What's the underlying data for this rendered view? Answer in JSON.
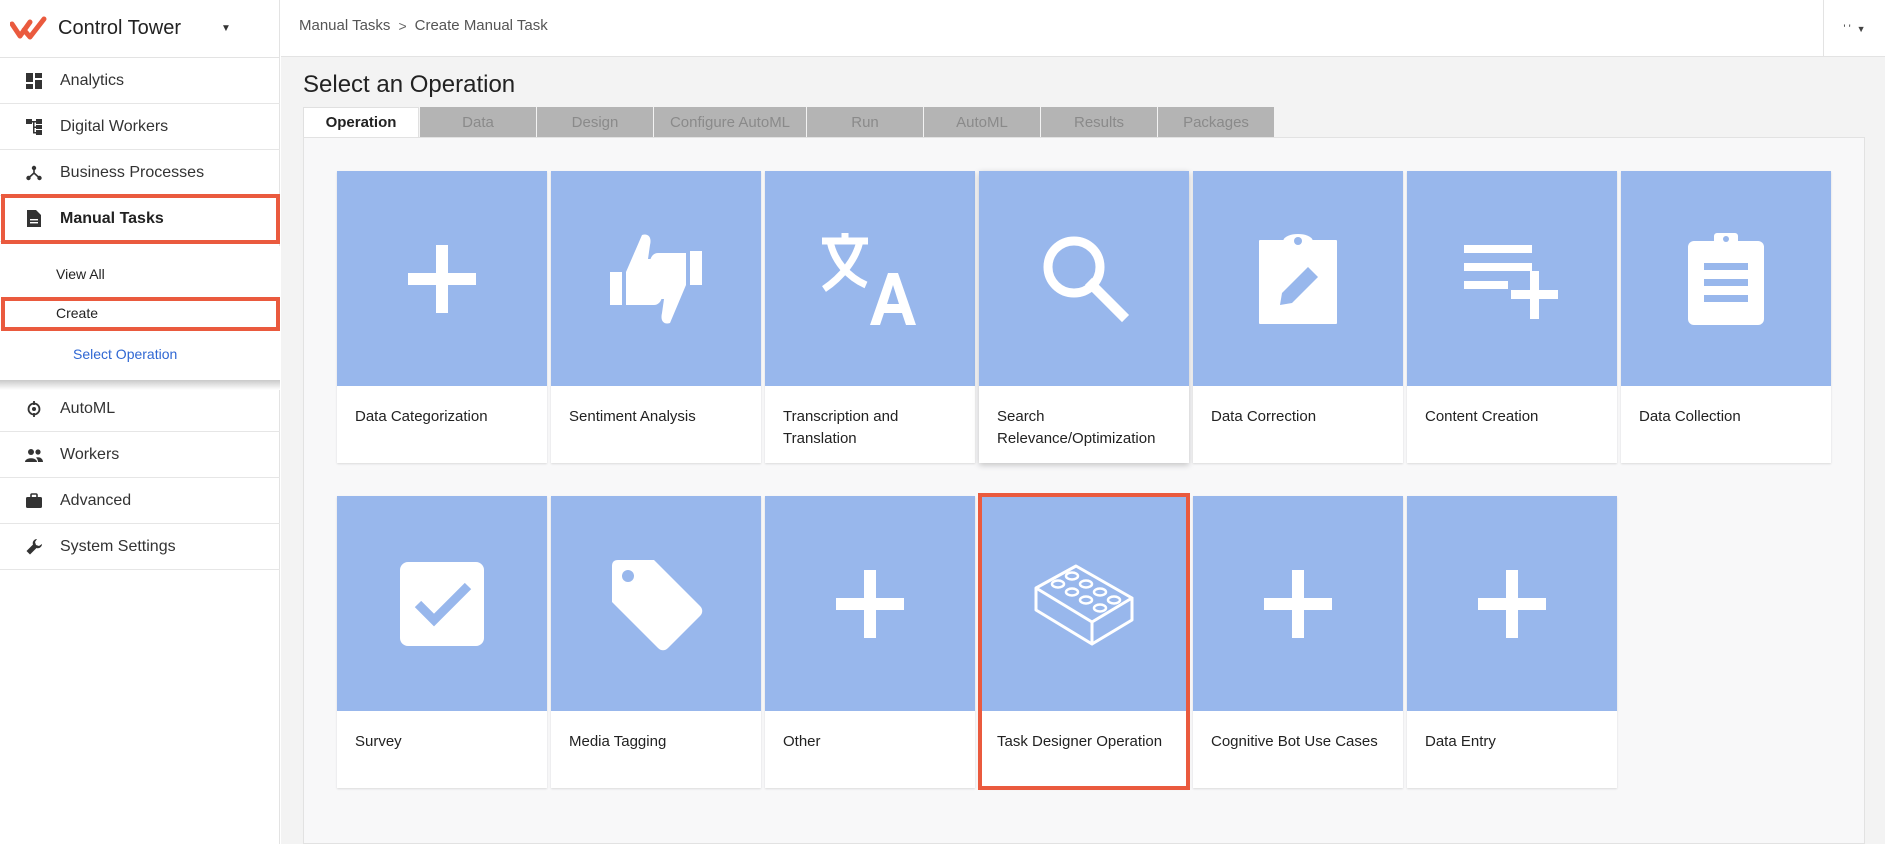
{
  "app": {
    "name": "Control Tower"
  },
  "user_menu": {
    "label": "' '"
  },
  "breadcrumb": [
    "Manual Tasks",
    "Create Manual Task"
  ],
  "sidebar": {
    "items": [
      {
        "label": "Analytics",
        "icon": "dashboard-icon"
      },
      {
        "label": "Digital Workers",
        "icon": "org-tree-icon"
      },
      {
        "label": "Business Processes",
        "icon": "process-hub-icon"
      },
      {
        "label": "Manual Tasks",
        "icon": "document-icon"
      },
      {
        "label": "AutoML",
        "icon": "automl-icon"
      },
      {
        "label": "Workers",
        "icon": "people-icon"
      },
      {
        "label": "Advanced",
        "icon": "briefcase-icon"
      },
      {
        "label": "System Settings",
        "icon": "wrench-icon"
      }
    ],
    "sub_items": {
      "view_all": "View All",
      "create": "Create",
      "select_operation": "Select Operation"
    }
  },
  "page": {
    "title": "Select an Operation"
  },
  "tabs": [
    "Operation",
    "Data",
    "Design",
    "Configure AutoML",
    "Run",
    "AutoML",
    "Results",
    "Packages"
  ],
  "operations": [
    {
      "label": "Data Categorization",
      "icon": "plus-icon"
    },
    {
      "label": "Sentiment Analysis",
      "icon": "thumbs-icon"
    },
    {
      "label": "Transcription and Translation",
      "icon": "translate-icon"
    },
    {
      "label": "Search Relevance/Optimization",
      "icon": "search-icon"
    },
    {
      "label": "Data Correction",
      "icon": "clipboard-edit-icon"
    },
    {
      "label": "Content Creation",
      "icon": "playlist-add-icon"
    },
    {
      "label": "Data Collection",
      "icon": "clipboard-list-icon"
    },
    {
      "label": "Survey",
      "icon": "checkbox-icon"
    },
    {
      "label": "Media Tagging",
      "icon": "tag-icon"
    },
    {
      "label": "Other",
      "icon": "plus-icon"
    },
    {
      "label": "Task Designer Operation",
      "icon": "brick-icon"
    },
    {
      "label": "Cognitive Bot Use Cases",
      "icon": "plus-icon"
    },
    {
      "label": "Data Entry",
      "icon": "plus-icon"
    }
  ],
  "colors": {
    "accent": "#ea5a3e",
    "tile": "#98b7ec",
    "link": "#2f67d3"
  }
}
